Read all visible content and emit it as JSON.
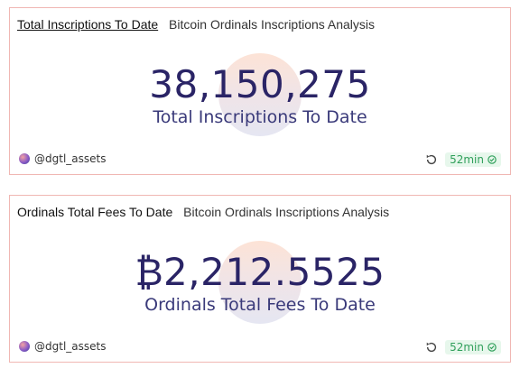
{
  "cards": [
    {
      "title": "Total Inscriptions To Date",
      "subtitle": "Bitcoin Ordinals Inscriptions Analysis",
      "value": "38,150,275",
      "label": "Total Inscriptions To Date",
      "author": "@dgtl_assets",
      "refresh_icon": "refresh-icon",
      "badge": "52min",
      "badge_icon": "check-circle-icon"
    },
    {
      "title": "Ordinals Total Fees To Date",
      "subtitle": "Bitcoin Ordinals Inscriptions Analysis",
      "value": "₿2,212.5525",
      "label": "Ordinals Total Fees To Date",
      "author": "@dgtl_assets",
      "refresh_icon": "refresh-icon",
      "badge": "52min",
      "badge_icon": "check-circle-icon"
    }
  ],
  "colors": {
    "border": "#f0b7b3",
    "value": "#2a2466",
    "badge_bg": "#e7f7ec",
    "badge_text": "#2f9f5a"
  }
}
